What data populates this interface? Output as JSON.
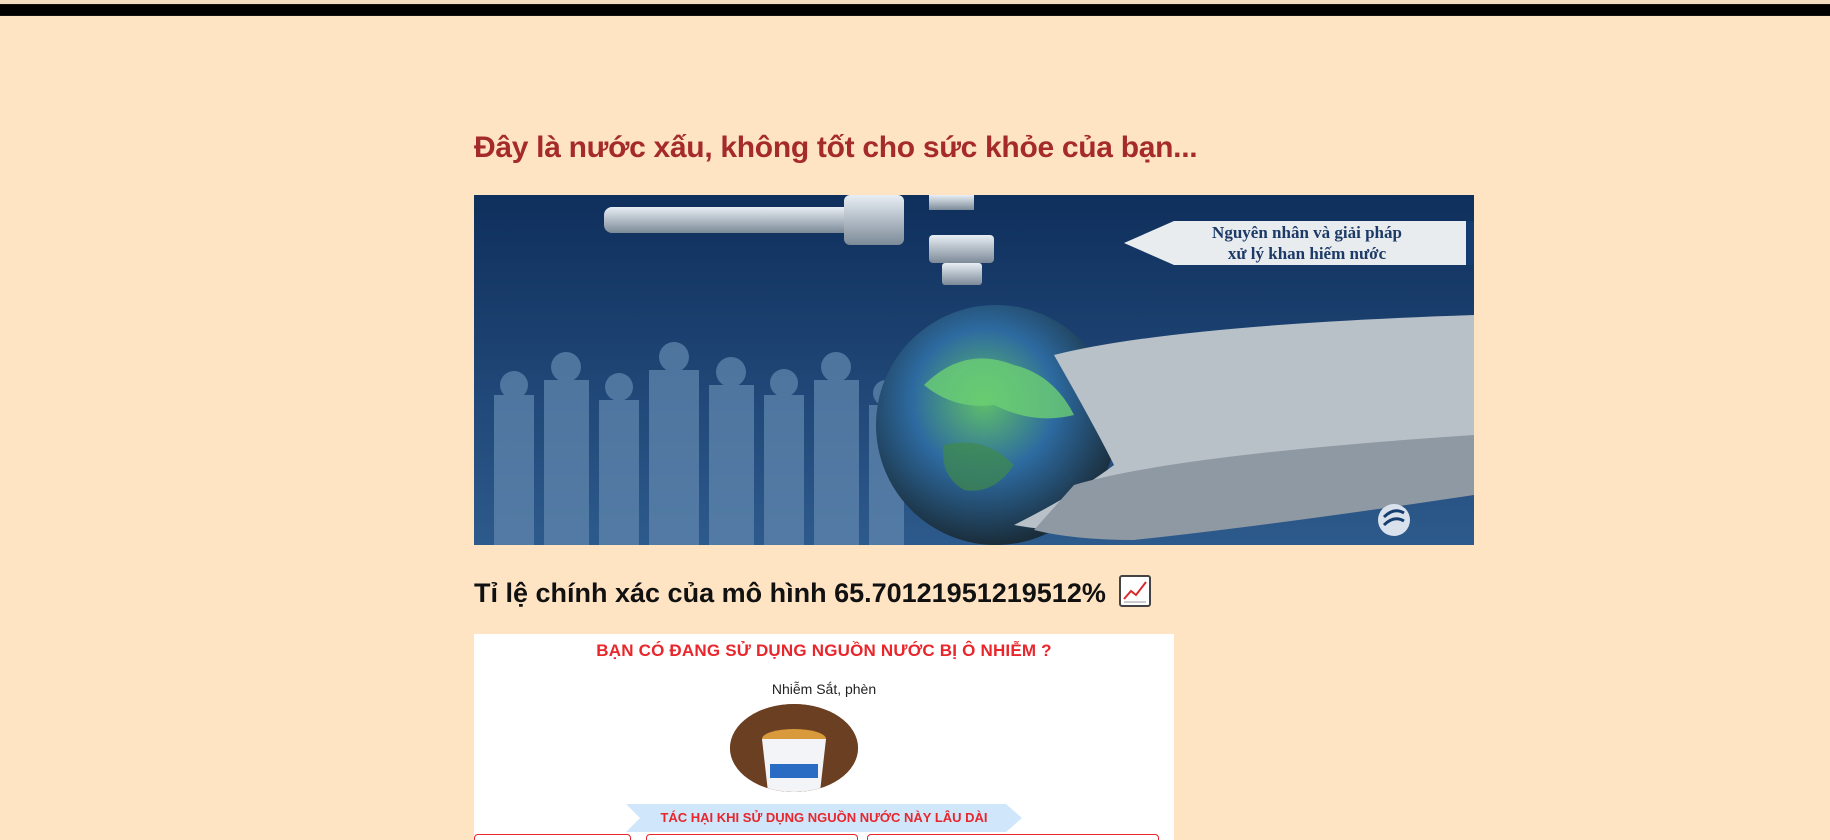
{
  "page": {
    "headline": "Đây là nước xấu, không tốt cho sức khỏe của bạn...",
    "accuracy_text": "Tỉ lệ chính xác của mô hình 65.70121951219512%",
    "accuracy_icon": "chart-increasing-icon"
  },
  "hero": {
    "banner_line1": "Nguyên nhân và giải pháp",
    "banner_line2": "xử lý khan hiếm nước",
    "logo_icon": "publisher-logo-icon"
  },
  "poster": {
    "title": "BẠN CÓ ĐANG SỬ DỤNG NGUỒN NƯỚC BỊ Ô NHIỄM  ?",
    "subtitle": "Nhiễm Sắt, phèn",
    "ribbon": "TÁC HẠI KHI SỬ DỤNG NGUỒN NƯỚC NÀY LÂU DÀI"
  },
  "colors": {
    "background": "#ffe4c4",
    "headline": "#a52a2a",
    "poster_red": "#e8262b"
  }
}
